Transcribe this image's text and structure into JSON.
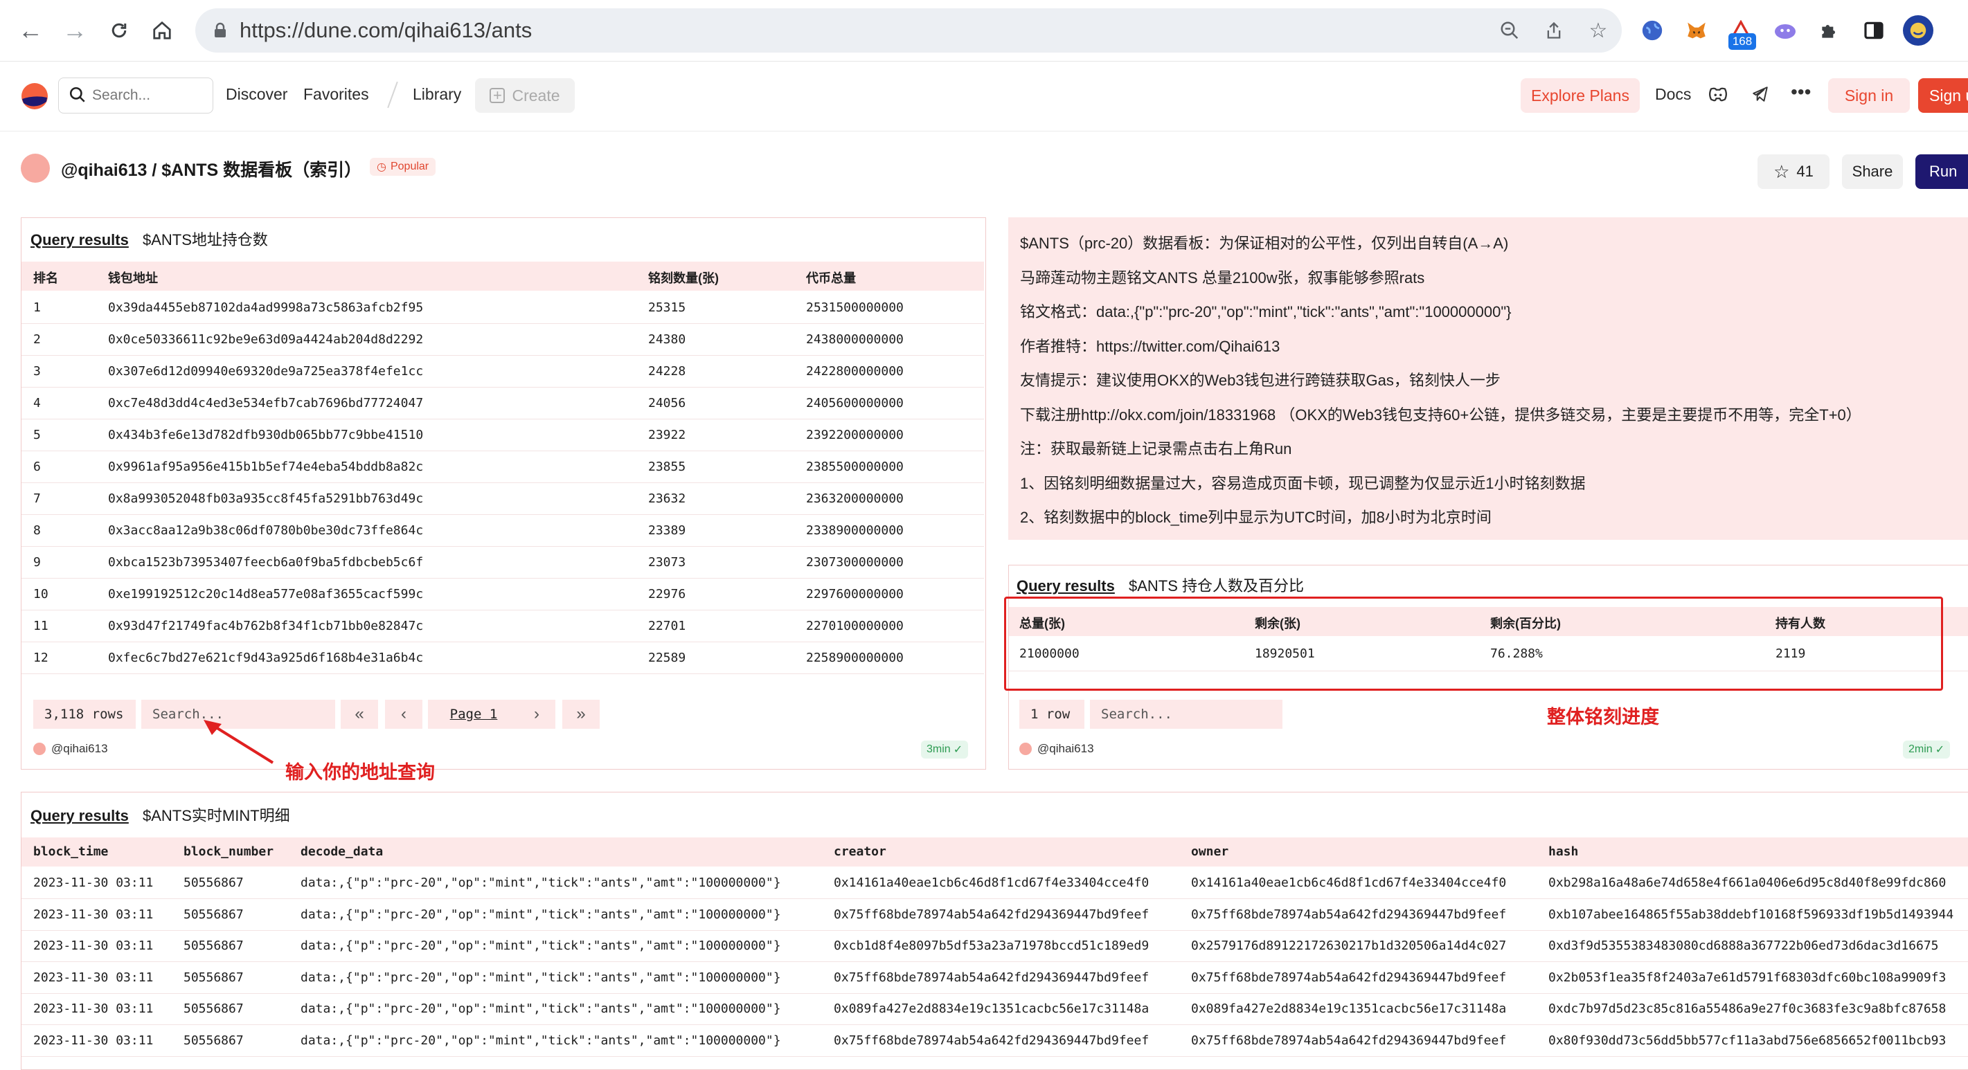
{
  "browser": {
    "url": "https://dune.com/qihai613/ants",
    "ext_badge": "168"
  },
  "header": {
    "search_placeholder": "Search...",
    "nav": [
      "Discover",
      "Favorites",
      "Library"
    ],
    "create_label": "Create",
    "explore_plans": "Explore Plans",
    "docs": "Docs",
    "sign_in": "Sign in",
    "sign_up": "Sign up"
  },
  "dashboard": {
    "title": "@qihai613 / $ANTS 数据看板（索引）",
    "badge": "Popular",
    "star_count": "41",
    "share": "Share",
    "run": "Run"
  },
  "holders": {
    "link": "Query results",
    "name": "$ANTS地址持仓数",
    "columns": [
      "排名",
      "钱包地址",
      "铭刻数量(张)",
      "代币总量"
    ],
    "rows": [
      [
        "1",
        "0x39da4455eb87102da4ad9998a73c5863afcb2f95",
        "25315",
        "2531500000000"
      ],
      [
        "2",
        "0x0ce50336611c92be9e63d09a4424ab204d8d2292",
        "24380",
        "2438000000000"
      ],
      [
        "3",
        "0x307e6d12d09940e69320de9a725ea378f4efe1cc",
        "24228",
        "2422800000000"
      ],
      [
        "4",
        "0xc7e48d3dd4c4ed3e534efb7cab7696bd77724047",
        "24056",
        "2405600000000"
      ],
      [
        "5",
        "0x434b3fe6e13d782dfb930db065bb77c9bbe41510",
        "23922",
        "2392200000000"
      ],
      [
        "6",
        "0x9961af95a956e415b1b5ef74e4eba54bddb8a82c",
        "23855",
        "2385500000000"
      ],
      [
        "7",
        "0x8a993052048fb03a935cc8f45fa5291bb763d49c",
        "23632",
        "2363200000000"
      ],
      [
        "8",
        "0x3acc8aa12a9b38c06df0780b0be30dc73ffe864c",
        "23389",
        "2338900000000"
      ],
      [
        "9",
        "0xbca1523b73953407feecb6a0f9ba5fdbcbeb5c6f",
        "23073",
        "2307300000000"
      ],
      [
        "10",
        "0xe199192512c20c14d8ea577e08af3655cacf599c",
        "22976",
        "2297600000000"
      ],
      [
        "11",
        "0x93d47f21749fac4b762b8f34f1cb71bb0e82847c",
        "22701",
        "2270100000000"
      ],
      [
        "12",
        "0xfec6c7bd27e621cf9d43a925d6f168b4e31a6b4c",
        "22589",
        "2258900000000"
      ]
    ],
    "row_count": "3,118 rows",
    "search_placeholder": "Search...",
    "page_label": "Page 1",
    "author": "@qihai613",
    "age": "3min"
  },
  "info": {
    "lines": [
      "$ANTS（prc-20）数据看板：为保证相对的公平性，仅列出自转自(A→A)",
      "马蹄莲动物主题铭文ANTS 总量2100w张，叙事能够参照rats",
      "铭文格式：data:,{\"p\":\"prc-20\",\"op\":\"mint\",\"tick\":\"ants\",\"amt\":\"100000000\"}",
      "作者推特：https://twitter.com/Qihai613",
      "友情提示：建议使用OKX的Web3钱包进行跨链获取Gas，铭刻快人一步",
      "下载注册http://okx.com/join/18331968 （OKX的Web3钱包支持60+公链，提供多链交易，主要是主要提币不用等，完全T+0）",
      "注：获取最新链上记录需点击右上角Run",
      "1、因铭刻明细数据量过大，容易造成页面卡顿，现已调整为仅显示近1小时铭刻数据",
      "2、铭刻数据中的block_time列中显示为UTC时间，加8小时为北京时间"
    ]
  },
  "supply": {
    "link": "Query results",
    "name": "$ANTS 持仓人数及百分比",
    "columns": [
      "总量(张)",
      "剩余(张)",
      "剩余(百分比)",
      "持有人数"
    ],
    "row": [
      "21000000",
      "18920501",
      "76.288%",
      "2119"
    ],
    "row_count": "1 row",
    "search_placeholder": "Search...",
    "author": "@qihai613",
    "age": "2min"
  },
  "mints": {
    "link": "Query results",
    "name": "$ANTS实时MINT明细",
    "columns": [
      "block_time",
      "block_number",
      "decode_data",
      "creator",
      "owner",
      "hash"
    ],
    "rows": [
      [
        "2023-11-30 03:11",
        "50556867",
        "data:,{\"p\":\"prc-20\",\"op\":\"mint\",\"tick\":\"ants\",\"amt\":\"100000000\"}",
        "0x14161a40eae1cb6c46d8f1cd67f4e33404cce4f0",
        "0x14161a40eae1cb6c46d8f1cd67f4e33404cce4f0",
        "0xb298a16a48a6e74d658e4f661a0406e6d95c8d40f8e99fdc860"
      ],
      [
        "2023-11-30 03:11",
        "50556867",
        "data:,{\"p\":\"prc-20\",\"op\":\"mint\",\"tick\":\"ants\",\"amt\":\"100000000\"}",
        "0x75ff68bde78974ab54a642fd294369447bd9feef",
        "0x75ff68bde78974ab54a642fd294369447bd9feef",
        "0xb107abee164865f55ab38ddebf10168f596933df19b5d1493944"
      ],
      [
        "2023-11-30 03:11",
        "50556867",
        "data:,{\"p\":\"prc-20\",\"op\":\"mint\",\"tick\":\"ants\",\"amt\":\"100000000\"}",
        "0xcb1d8f4e8097b5df53a23a71978bccd51c189ed9",
        "0x2579176d89122172630217b1d320506a14d4c027",
        "0xd3f9d5355383483080cd6888a367722b06ed73d6dac3d16675"
      ],
      [
        "2023-11-30 03:11",
        "50556867",
        "data:,{\"p\":\"prc-20\",\"op\":\"mint\",\"tick\":\"ants\",\"amt\":\"100000000\"}",
        "0x75ff68bde78974ab54a642fd294369447bd9feef",
        "0x75ff68bde78974ab54a642fd294369447bd9feef",
        "0x2b053f1ea35f8f2403a7e61d5791f68303dfc60bc108a9909f3"
      ],
      [
        "2023-11-30 03:11",
        "50556867",
        "data:,{\"p\":\"prc-20\",\"op\":\"mint\",\"tick\":\"ants\",\"amt\":\"100000000\"}",
        "0x089fa427e2d8834e19c1351cacbc56e17c31148a",
        "0x089fa427e2d8834e19c1351cacbc56e17c31148a",
        "0xdc7b97d5d23c85c816a55486a9e27f0c3683fe3c9a8bfc87658"
      ],
      [
        "2023-11-30 03:11",
        "50556867",
        "data:,{\"p\":\"prc-20\",\"op\":\"mint\",\"tick\":\"ants\",\"amt\":\"100000000\"}",
        "0x75ff68bde78974ab54a642fd294369447bd9feef",
        "0x75ff68bde78974ab54a642fd294369447bd9feef",
        "0x80f930dd73c56dd5bb577cf11a3abd756e6856652f0011bcb93"
      ]
    ]
  },
  "annotations": {
    "address_hint": "输入你的地址查询",
    "progress_hint": "整体铭刻进度"
  },
  "colors": {
    "accent": "#e8462f",
    "pink": "#fde8e8",
    "annotation_red": "#e02020"
  }
}
